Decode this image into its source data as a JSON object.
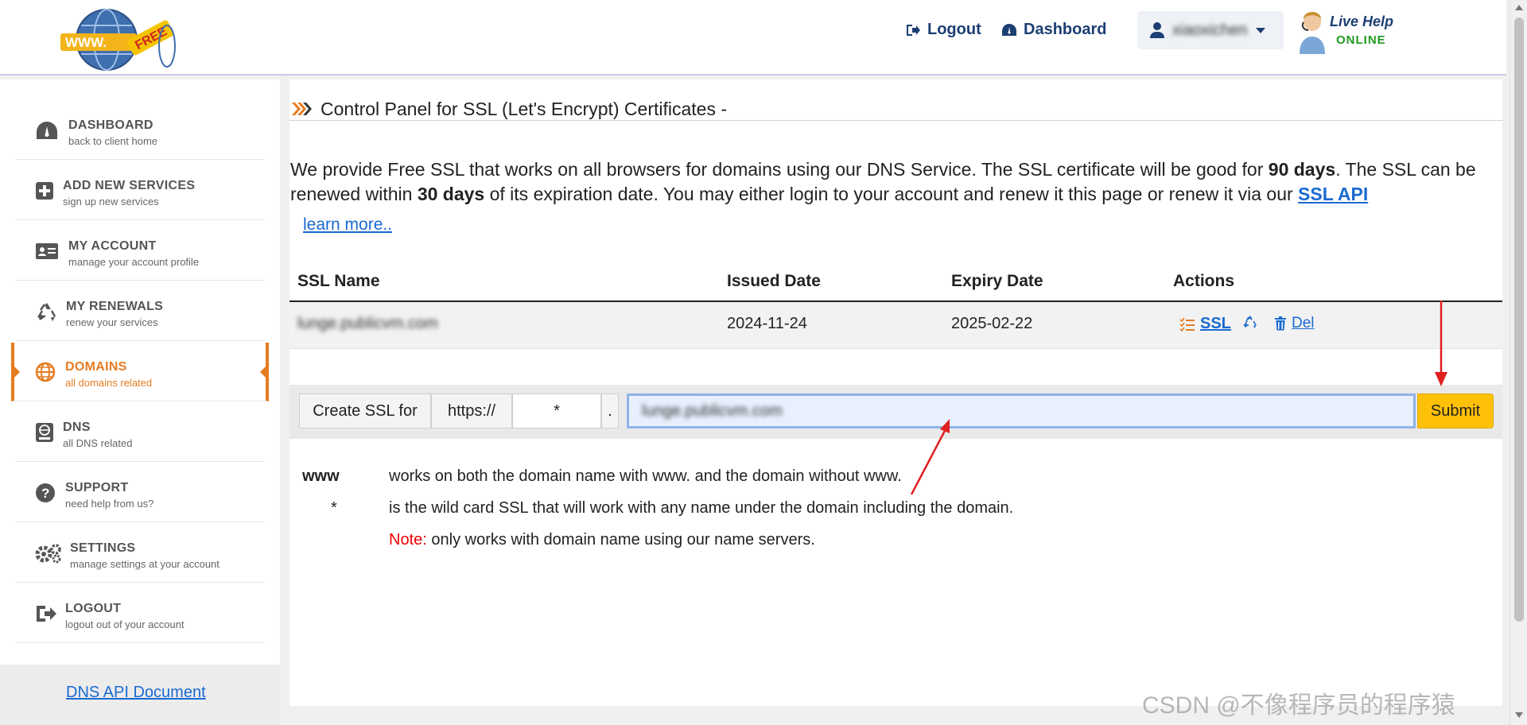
{
  "header": {
    "logout_label": "Logout",
    "dashboard_label": "Dashboard",
    "username": "xiaoxichen",
    "live_help_line1": "Live Help",
    "live_help_line2": "ONLINE",
    "logo_text": "WWW FREE"
  },
  "sidebar": {
    "items": [
      {
        "title": "DASHBOARD",
        "subtitle": "back to client home",
        "icon": "dashboard-gauge-icon"
      },
      {
        "title": "ADD NEW SERVICES",
        "subtitle": "sign up new services",
        "icon": "plus-square-icon"
      },
      {
        "title": "MY ACCOUNT",
        "subtitle": "manage your account profile",
        "icon": "id-card-icon"
      },
      {
        "title": "MY RENEWALS",
        "subtitle": "renew your services",
        "icon": "recycle-icon"
      },
      {
        "title": "DOMAINS",
        "subtitle": "all domains related",
        "icon": "globe-icon"
      },
      {
        "title": "DNS",
        "subtitle": "all DNS related",
        "icon": "dns-server-icon"
      },
      {
        "title": "SUPPORT",
        "subtitle": "need help from us?",
        "icon": "question-circle-icon"
      },
      {
        "title": "SETTINGS",
        "subtitle": "manage settings at your account",
        "icon": "gears-icon"
      },
      {
        "title": "LOGOUT",
        "subtitle": "logout out of your account",
        "icon": "sign-out-icon"
      }
    ],
    "active_item": "DOMAINS",
    "footer_link": "DNS API Document"
  },
  "main": {
    "panel_title": "Control Panel for SSL (Let's Encrypt) Certificates -",
    "intro": {
      "part1": "We provide Free SSL that works on all browsers for domains using our DNS Service. The SSL certificate will be good for ",
      "bold1": "90 days",
      "part2": ". The SSL can be renewed within ",
      "bold2": "30 days",
      "part3": " of its expiration date. You may either login to your account and renew it this page or renew it via our ",
      "link": "SSL API"
    },
    "learn_more": "learn more..",
    "table": {
      "headers": [
        "SSL Name",
        "Issued Date",
        "Expiry Date",
        "Actions"
      ],
      "rows": [
        {
          "ssl_name": "lunge.publicvm.com",
          "issued": "2024-11-24",
          "expiry": "2025-02-22",
          "action_ssl": "SSL",
          "action_del": "Del"
        }
      ]
    },
    "create_form": {
      "label": "Create SSL for",
      "protocol": "https://",
      "subdomain_value": "*",
      "dot": ".",
      "domain_value": "lunge.publicvm.com",
      "submit_label": "Submit"
    },
    "notes": [
      {
        "key": "www",
        "text": "works on both the domain name with www. and the domain without www."
      },
      {
        "key": "*",
        "text": "is the wild card SSL that will work with any name under the domain including the domain."
      },
      {
        "key": "",
        "note_label": "Note:",
        "text": "only works with domain name using our name servers."
      }
    ]
  },
  "watermark": "CSDN @不像程序员的程序猿",
  "colors": {
    "accent_orange": "#e57c22",
    "link_blue": "#1a6ad1",
    "submit_yellow": "#ffc107",
    "nav_blue": "#1c3f73",
    "annotation_red": "#e02020"
  }
}
